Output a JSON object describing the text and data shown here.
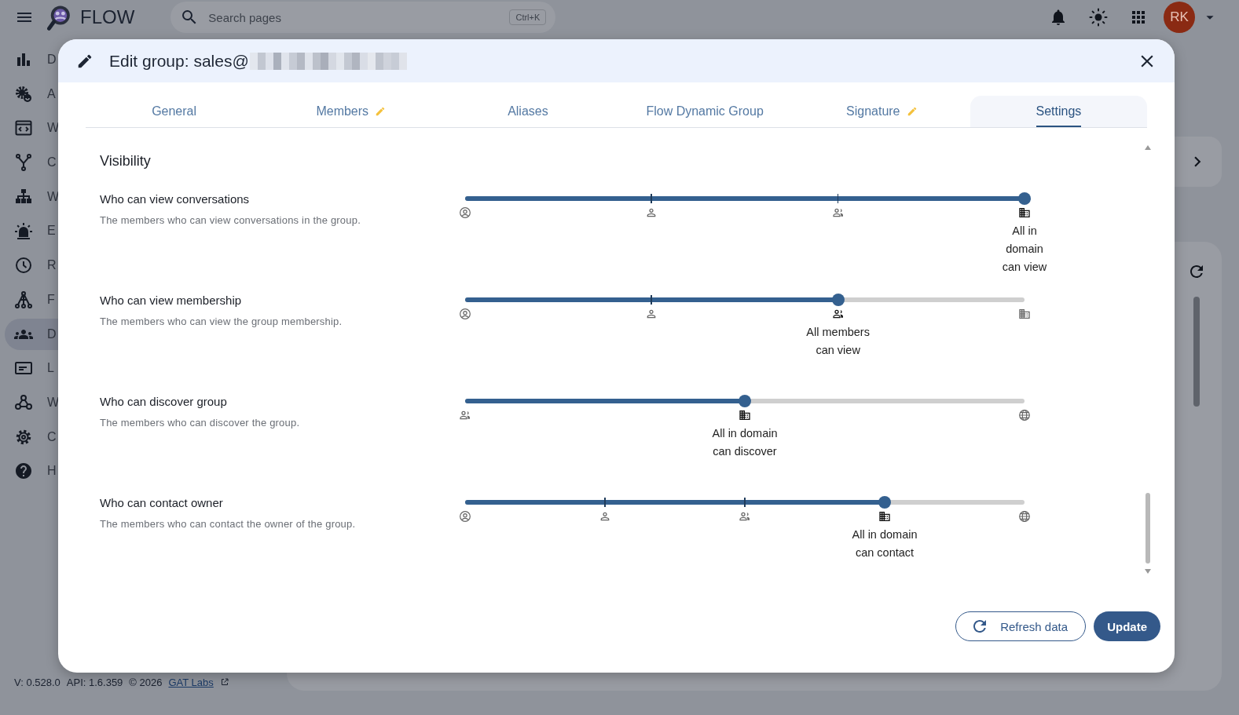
{
  "app": {
    "title": "FLOW",
    "search": {
      "placeholder": "Search pages",
      "shortcut": "Ctrl+K"
    },
    "avatar": "RK"
  },
  "sidebar": {
    "items": [
      {
        "label": "D",
        "kind": "chart",
        "selected": false
      },
      {
        "label": "A",
        "kind": "gear-sync",
        "selected": false
      },
      {
        "label": "W",
        "kind": "window",
        "selected": false
      },
      {
        "label": "C",
        "kind": "fork",
        "selected": false
      },
      {
        "label": "W",
        "kind": "sitemap",
        "selected": false
      },
      {
        "label": "E",
        "kind": "siren",
        "selected": false
      },
      {
        "label": "R",
        "kind": "clock",
        "selected": false
      },
      {
        "label": "F",
        "kind": "network",
        "selected": false
      },
      {
        "label": "D",
        "kind": "group",
        "selected": true
      },
      {
        "label": "L",
        "kind": "card",
        "selected": false
      },
      {
        "label": "W",
        "kind": "webhook",
        "selected": false
      },
      {
        "label": "C",
        "kind": "gear",
        "selected": false
      },
      {
        "label": "H",
        "kind": "help",
        "selected": false
      }
    ]
  },
  "footer": {
    "version": "V: 0.528.0",
    "api": "API: 1.6.359",
    "copyright": "© 2026",
    "link": "GAT Labs"
  },
  "dialog": {
    "title": "Edit group: sales@",
    "tabs": [
      {
        "label": "General",
        "edited": false,
        "selected": false
      },
      {
        "label": "Members",
        "edited": true,
        "selected": false
      },
      {
        "label": "Aliases",
        "edited": false,
        "selected": false
      },
      {
        "label": "Flow Dynamic Group",
        "edited": false,
        "selected": false
      },
      {
        "label": "Signature",
        "edited": true,
        "selected": false
      },
      {
        "label": "Settings",
        "edited": false,
        "selected": true
      }
    ],
    "section": "Visibility",
    "settings": [
      {
        "title": "Who can view conversations",
        "description": "The members who can view conversations in the group.",
        "level": 1,
        "value_label": "All in domain can view",
        "stops": [
          {
            "kind": "owner",
            "selected": false
          },
          {
            "kind": "manager",
            "selected": false
          },
          {
            "kind": "members",
            "selected": false
          },
          {
            "kind": "domain",
            "selected": true
          }
        ]
      },
      {
        "title": "Who can view membership",
        "description": "The members who can view the group membership.",
        "level": 0.6667,
        "value_label": "All members can view",
        "stops": [
          {
            "kind": "owner",
            "selected": false
          },
          {
            "kind": "manager",
            "selected": false
          },
          {
            "kind": "members",
            "selected": true
          },
          {
            "kind": "domain",
            "selected": false
          }
        ]
      },
      {
        "title": "Who can discover group",
        "description": "The members who can discover the group.",
        "level": 0.5,
        "value_label": "All in domain can discover",
        "stops": [
          {
            "kind": "members",
            "selected": false
          },
          {
            "kind": "domain",
            "selected": true
          },
          {
            "kind": "anyone",
            "selected": false
          }
        ]
      },
      {
        "title": "Who can contact owner",
        "description": "The members who can contact the owner of the group.",
        "level": 0.75,
        "value_label": "All in domain can contact",
        "stops": [
          {
            "kind": "owner",
            "selected": false
          },
          {
            "kind": "manager",
            "selected": false
          },
          {
            "kind": "members",
            "selected": false
          },
          {
            "kind": "domain",
            "selected": true
          },
          {
            "kind": "anyone",
            "selected": false
          }
        ]
      }
    ],
    "buttons": [
      {
        "label": "Refresh data",
        "kind": "outlined"
      },
      {
        "label": "Update",
        "kind": "filled"
      }
    ]
  }
}
